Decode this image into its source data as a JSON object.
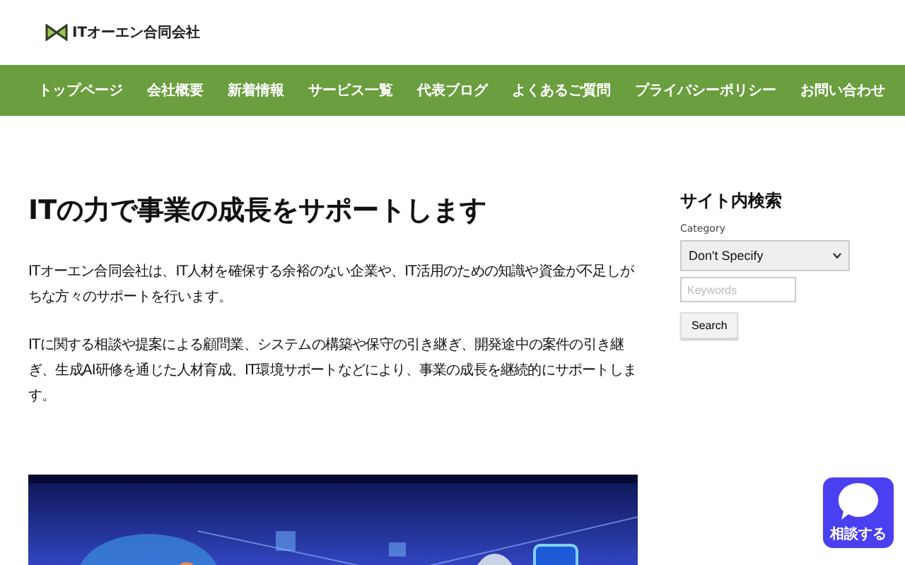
{
  "header": {
    "logo_text": "ITオーエン合同会社"
  },
  "nav": {
    "items": [
      {
        "label": "トップページ"
      },
      {
        "label": "会社概要"
      },
      {
        "label": "新着情報"
      },
      {
        "label": "サービス一覧"
      },
      {
        "label": "代表ブログ"
      },
      {
        "label": "よくあるご質問"
      },
      {
        "label": "プライバシーポリシー"
      },
      {
        "label": "お問い合わせ"
      }
    ]
  },
  "main": {
    "heading": "ITの力で事業の成長をサポートします",
    "paragraphs": [
      "ITオーエン合同会社は、IT人材を確保する余裕のない企業や、IT活用のための知識や資金が不足しがちな方々のサポートを行います。",
      "ITに関する相談や提案による顧問業、システムの構築や保守の引き継ぎ、開発途中の案件の引き継ぎ、生成AI研修を通じた人材育成、IT環境サポートなどにより、事業の成長を継続的にサポートします。"
    ]
  },
  "sidebar": {
    "title": "サイト内検索",
    "category_label": "Category",
    "category_value": "Don't Specify",
    "keyword_placeholder": "Keywords",
    "search_button": "Search"
  },
  "chat_button": {
    "label": "相談する"
  }
}
